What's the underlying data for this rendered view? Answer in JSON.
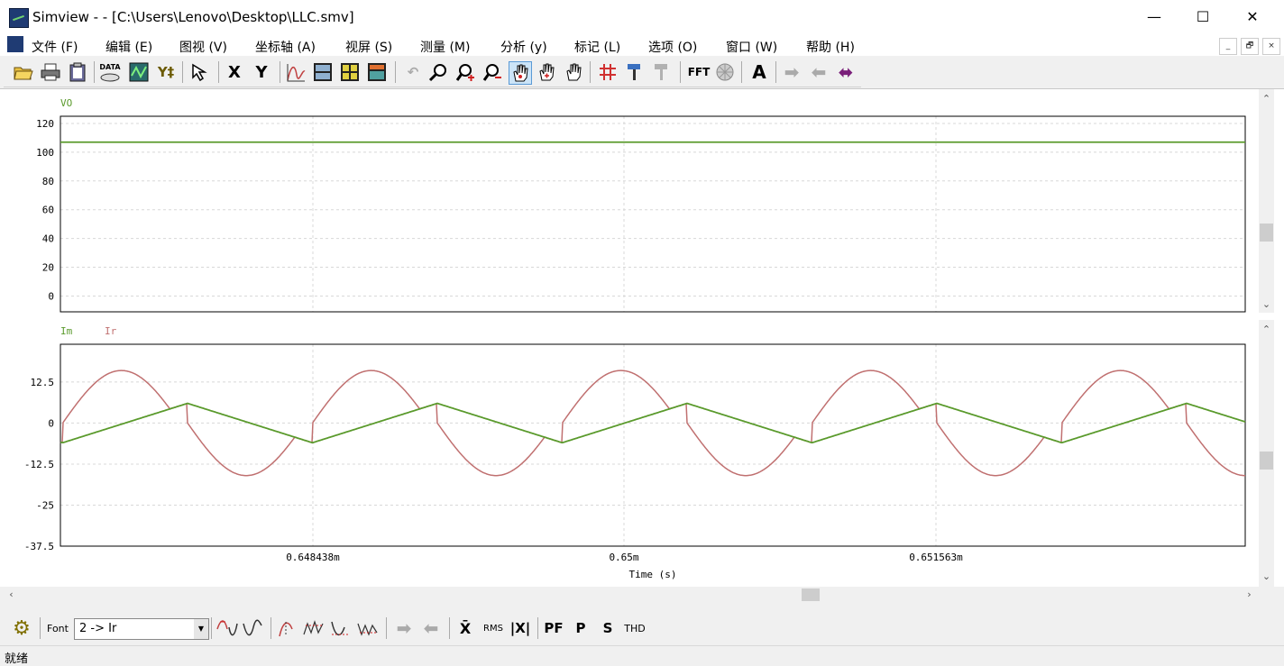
{
  "window": {
    "title": "Simview -  - [C:\\Users\\Lenovo\\Desktop\\LLC.smv]",
    "minimize": "—",
    "maximize": "☐",
    "close": "✕"
  },
  "menu": [
    "文件 (F)",
    "编辑 (E)",
    "图视 (V)",
    "坐标轴 (A)",
    "视屏 (S)",
    "测量 (M)",
    "分析 (y)",
    "标记 (L)",
    "选项 (O)",
    "窗口 (W)",
    "帮助 (H)"
  ],
  "mdi": {
    "min": "_",
    "restore": "🗗",
    "close": "×"
  },
  "toolbar": {
    "data_label": "DATA",
    "x_label": "X",
    "y_label": "Y",
    "fft_label": "FFT",
    "text_label": "A"
  },
  "chart_data": [
    {
      "type": "line",
      "title": "",
      "legend": [
        "VO"
      ],
      "series": [
        {
          "name": "VO",
          "color": "#5a9a2c",
          "x": [
            0.6468,
            0.6531
          ],
          "y": [
            107,
            107
          ]
        }
      ],
      "yticks": [
        "120",
        "100",
        "80",
        "60",
        "40",
        "20",
        "0"
      ],
      "ylim": [
        -11,
        125
      ],
      "xlim": [
        0.6468,
        0.6531
      ],
      "grid": true
    },
    {
      "type": "line",
      "title": "",
      "legend": [
        "Im",
        "Ir"
      ],
      "series": [
        {
          "name": "Im",
          "color": "#5a9a2c",
          "shape": "triangle",
          "amplitude": 6,
          "period_ms": 0.0012616
        },
        {
          "name": "Ir",
          "color": "#c07070",
          "shape": "piecewise-sine",
          "amplitude": 16,
          "period_ms": 0.0012616
        }
      ],
      "yticks": [
        "12.5",
        "0",
        "-12.5",
        "-25",
        "-37.5"
      ],
      "ylim": [
        -37.5,
        24
      ],
      "xlim": [
        0.6468,
        0.6531
      ],
      "xticks": [
        "0.648438m",
        "0.65m",
        "0.651563m"
      ],
      "xlabel": "Time (s)",
      "grid": true
    }
  ],
  "bottom_toolbar": {
    "font_label": "Font",
    "combo_value": "2 -> Ir",
    "pf_label": "PF",
    "p_label": "P",
    "s_label": "S",
    "thd_label": "THD",
    "rms_label": "RMS",
    "xbar_label": "X̄",
    "xabs_label": "|X|"
  },
  "status": {
    "text": "就绪"
  }
}
